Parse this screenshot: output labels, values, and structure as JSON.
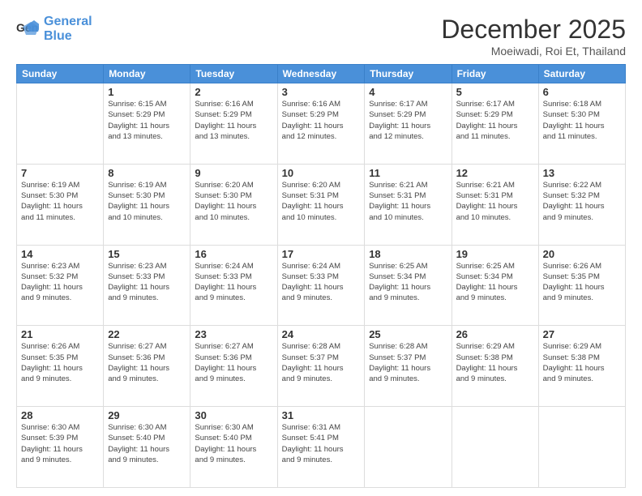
{
  "logo": {
    "line1": "General",
    "line2": "Blue"
  },
  "title": "December 2025",
  "subtitle": "Moeiwadi, Roi Et, Thailand",
  "weekdays": [
    "Sunday",
    "Monday",
    "Tuesday",
    "Wednesday",
    "Thursday",
    "Friday",
    "Saturday"
  ],
  "weeks": [
    [
      {
        "day": "",
        "info": ""
      },
      {
        "day": "1",
        "info": "Sunrise: 6:15 AM\nSunset: 5:29 PM\nDaylight: 11 hours\nand 13 minutes."
      },
      {
        "day": "2",
        "info": "Sunrise: 6:16 AM\nSunset: 5:29 PM\nDaylight: 11 hours\nand 13 minutes."
      },
      {
        "day": "3",
        "info": "Sunrise: 6:16 AM\nSunset: 5:29 PM\nDaylight: 11 hours\nand 12 minutes."
      },
      {
        "day": "4",
        "info": "Sunrise: 6:17 AM\nSunset: 5:29 PM\nDaylight: 11 hours\nand 12 minutes."
      },
      {
        "day": "5",
        "info": "Sunrise: 6:17 AM\nSunset: 5:29 PM\nDaylight: 11 hours\nand 11 minutes."
      },
      {
        "day": "6",
        "info": "Sunrise: 6:18 AM\nSunset: 5:30 PM\nDaylight: 11 hours\nand 11 minutes."
      }
    ],
    [
      {
        "day": "7",
        "info": "Sunrise: 6:19 AM\nSunset: 5:30 PM\nDaylight: 11 hours\nand 11 minutes."
      },
      {
        "day": "8",
        "info": "Sunrise: 6:19 AM\nSunset: 5:30 PM\nDaylight: 11 hours\nand 10 minutes."
      },
      {
        "day": "9",
        "info": "Sunrise: 6:20 AM\nSunset: 5:30 PM\nDaylight: 11 hours\nand 10 minutes."
      },
      {
        "day": "10",
        "info": "Sunrise: 6:20 AM\nSunset: 5:31 PM\nDaylight: 11 hours\nand 10 minutes."
      },
      {
        "day": "11",
        "info": "Sunrise: 6:21 AM\nSunset: 5:31 PM\nDaylight: 11 hours\nand 10 minutes."
      },
      {
        "day": "12",
        "info": "Sunrise: 6:21 AM\nSunset: 5:31 PM\nDaylight: 11 hours\nand 10 minutes."
      },
      {
        "day": "13",
        "info": "Sunrise: 6:22 AM\nSunset: 5:32 PM\nDaylight: 11 hours\nand 9 minutes."
      }
    ],
    [
      {
        "day": "14",
        "info": "Sunrise: 6:23 AM\nSunset: 5:32 PM\nDaylight: 11 hours\nand 9 minutes."
      },
      {
        "day": "15",
        "info": "Sunrise: 6:23 AM\nSunset: 5:33 PM\nDaylight: 11 hours\nand 9 minutes."
      },
      {
        "day": "16",
        "info": "Sunrise: 6:24 AM\nSunset: 5:33 PM\nDaylight: 11 hours\nand 9 minutes."
      },
      {
        "day": "17",
        "info": "Sunrise: 6:24 AM\nSunset: 5:33 PM\nDaylight: 11 hours\nand 9 minutes."
      },
      {
        "day": "18",
        "info": "Sunrise: 6:25 AM\nSunset: 5:34 PM\nDaylight: 11 hours\nand 9 minutes."
      },
      {
        "day": "19",
        "info": "Sunrise: 6:25 AM\nSunset: 5:34 PM\nDaylight: 11 hours\nand 9 minutes."
      },
      {
        "day": "20",
        "info": "Sunrise: 6:26 AM\nSunset: 5:35 PM\nDaylight: 11 hours\nand 9 minutes."
      }
    ],
    [
      {
        "day": "21",
        "info": "Sunrise: 6:26 AM\nSunset: 5:35 PM\nDaylight: 11 hours\nand 9 minutes."
      },
      {
        "day": "22",
        "info": "Sunrise: 6:27 AM\nSunset: 5:36 PM\nDaylight: 11 hours\nand 9 minutes."
      },
      {
        "day": "23",
        "info": "Sunrise: 6:27 AM\nSunset: 5:36 PM\nDaylight: 11 hours\nand 9 minutes."
      },
      {
        "day": "24",
        "info": "Sunrise: 6:28 AM\nSunset: 5:37 PM\nDaylight: 11 hours\nand 9 minutes."
      },
      {
        "day": "25",
        "info": "Sunrise: 6:28 AM\nSunset: 5:37 PM\nDaylight: 11 hours\nand 9 minutes."
      },
      {
        "day": "26",
        "info": "Sunrise: 6:29 AM\nSunset: 5:38 PM\nDaylight: 11 hours\nand 9 minutes."
      },
      {
        "day": "27",
        "info": "Sunrise: 6:29 AM\nSunset: 5:38 PM\nDaylight: 11 hours\nand 9 minutes."
      }
    ],
    [
      {
        "day": "28",
        "info": "Sunrise: 6:30 AM\nSunset: 5:39 PM\nDaylight: 11 hours\nand 9 minutes."
      },
      {
        "day": "29",
        "info": "Sunrise: 6:30 AM\nSunset: 5:40 PM\nDaylight: 11 hours\nand 9 minutes."
      },
      {
        "day": "30",
        "info": "Sunrise: 6:30 AM\nSunset: 5:40 PM\nDaylight: 11 hours\nand 9 minutes."
      },
      {
        "day": "31",
        "info": "Sunrise: 6:31 AM\nSunset: 5:41 PM\nDaylight: 11 hours\nand 9 minutes."
      },
      {
        "day": "",
        "info": ""
      },
      {
        "day": "",
        "info": ""
      },
      {
        "day": "",
        "info": ""
      }
    ]
  ]
}
